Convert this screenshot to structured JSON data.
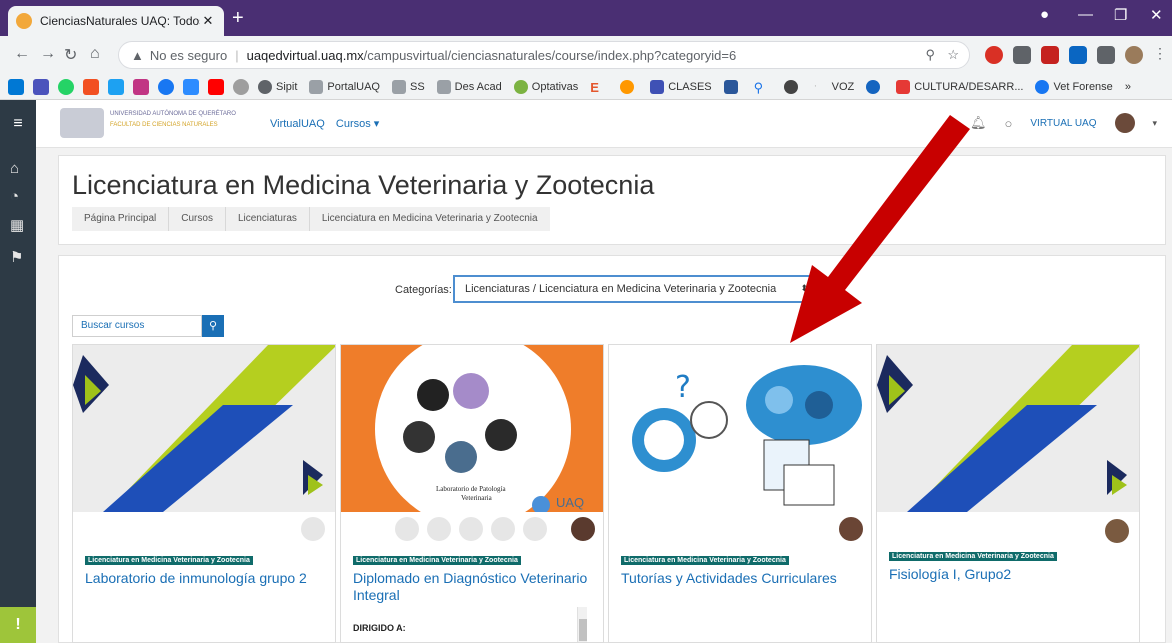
{
  "browser": {
    "tab_title": "CienciasNaturales UAQ: Todos lo",
    "tab_close": "✕",
    "new_tab": "+",
    "security": "No es seguro",
    "url_host": "uaqedvirtual.uaq.mx",
    "url_path": "/campusvirtual/cienciasnaturales/course/index.php?categoryid=6",
    "bookmarks": [
      "Sipit",
      "PortalUAQ",
      "SS",
      "Des Acad",
      "Optativas",
      "CLASES",
      "VOZ",
      "CULTURA/DESARR...",
      "Vet Forense"
    ],
    "bookmarks_more": "»"
  },
  "site": {
    "logo_line1": "UNIVERSIDAD AUTÓNOMA DE QUERÉTARO",
    "logo_line2": "FACULTAD DE CIENCIAS NATURALES",
    "nav_home": "VirtualUAQ",
    "nav_courses": "Cursos ▾",
    "user_name": "VIRTUAL UAQ"
  },
  "page": {
    "title": "Licenciatura en Medicina Veterinaria y Zootecnia",
    "breadcrumbs": [
      "Página Principal",
      "Cursos",
      "Licenciaturas",
      "Licenciatura en Medicina Veterinaria y Zootecnia"
    ],
    "category_label": "Categorías:",
    "category_value": "Licenciaturas / Licenciatura en Medicina Veterinaria y Zootecnia",
    "search_placeholder": "Buscar cursos"
  },
  "courses": [
    {
      "category": "Licenciatura en Medicina Veterinaria y Zootecnia",
      "name": "Laboratorio de inmunología grupo 2",
      "summary": ""
    },
    {
      "category": "Licenciatura en Medicina Veterinaria y Zootecnia",
      "name": "Diplomado en Diagnóstico Veterinario Integral",
      "summary": "DIRIGIDO A:",
      "img_text1": "Laboratorio de Patología",
      "img_text2": "Veterinaria",
      "img_text3": "UAQ"
    },
    {
      "category": "Licenciatura en Medicina Veterinaria y Zootecnia",
      "name": "Tutorías y Actividades Curriculares",
      "summary": ""
    },
    {
      "category": "Licenciatura en Medicina Veterinaria y Zootecnia",
      "name": "Fisiología I, Grupo2",
      "summary": ""
    }
  ],
  "colors": {
    "tabstrip": "#4a2f73",
    "link": "#1a6fb5",
    "badge": "#0f6b6a",
    "sidebar": "#2d3a45",
    "arrow": "#c80000"
  }
}
